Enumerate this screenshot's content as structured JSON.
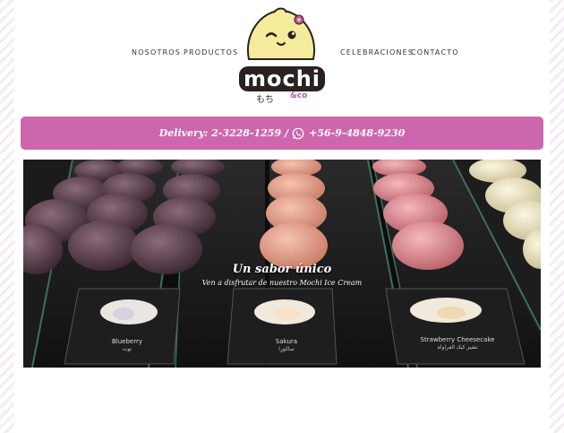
{
  "nav": {
    "items": [
      {
        "label": "NOSOTROS"
      },
      {
        "label": "PRODUCTOS"
      },
      {
        "label": "CELEBRACIONES"
      },
      {
        "label": "CONTACTO"
      }
    ]
  },
  "logo": {
    "word": "mochi",
    "japanese": "もち",
    "suffix": "&co"
  },
  "delivery": {
    "phone_label": "Delivery: 2-3228-1259",
    "separator": "/",
    "whatsapp_label": "+56-9-4848-9230",
    "icon": "whatsapp-icon"
  },
  "hero": {
    "title": "Un sabor único",
    "subtitle": "Ven a disfrutar de nuestro Mochi Ice Cream",
    "cards": [
      {
        "label": "Blueberry",
        "label_ar": "توت"
      },
      {
        "label": "Sakura",
        "label_ar": "ساكورا"
      },
      {
        "label": "Strawberry Cheesecake",
        "label_ar": "تشيز كيك الفراولة"
      }
    ]
  },
  "colors": {
    "accent": "#cd67ad",
    "logo_yellow": "#f4ec9a",
    "logo_dark": "#2b2121"
  }
}
